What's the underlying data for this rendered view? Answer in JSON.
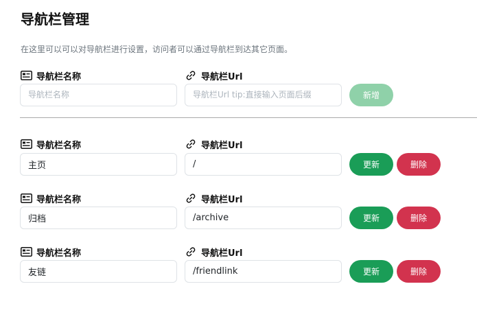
{
  "header": {
    "title": "导航栏管理",
    "description": "在这里可以可以对导航栏进行设置，访问者可以通过导航栏到达其它页面。"
  },
  "form": {
    "name_label": "导航栏名称",
    "url_label": "导航栏Url",
    "name_placeholder": "导航栏名称",
    "url_placeholder": "导航栏Url tip:直接输入页面后缀",
    "add_label": "新增"
  },
  "items": [
    {
      "name_label": "导航栏名称",
      "url_label": "导航栏Url",
      "name": "主页",
      "url": "/",
      "update_label": "更新",
      "delete_label": "删除"
    },
    {
      "name_label": "导航栏名称",
      "url_label": "导航栏Url",
      "name": "归档",
      "url": "/archive",
      "update_label": "更新",
      "delete_label": "删除"
    },
    {
      "name_label": "导航栏名称",
      "url_label": "导航栏Url",
      "name": "友链",
      "url": "/friendlink",
      "update_label": "更新",
      "delete_label": "删除"
    }
  ],
  "icons": {
    "name_field": "card-icon",
    "url_field": "link-icon"
  },
  "colors": {
    "add_button": "#8fd1a9",
    "update_button": "#1a9d57",
    "delete_button": "#d2334e",
    "description_text": "#6c757d"
  }
}
